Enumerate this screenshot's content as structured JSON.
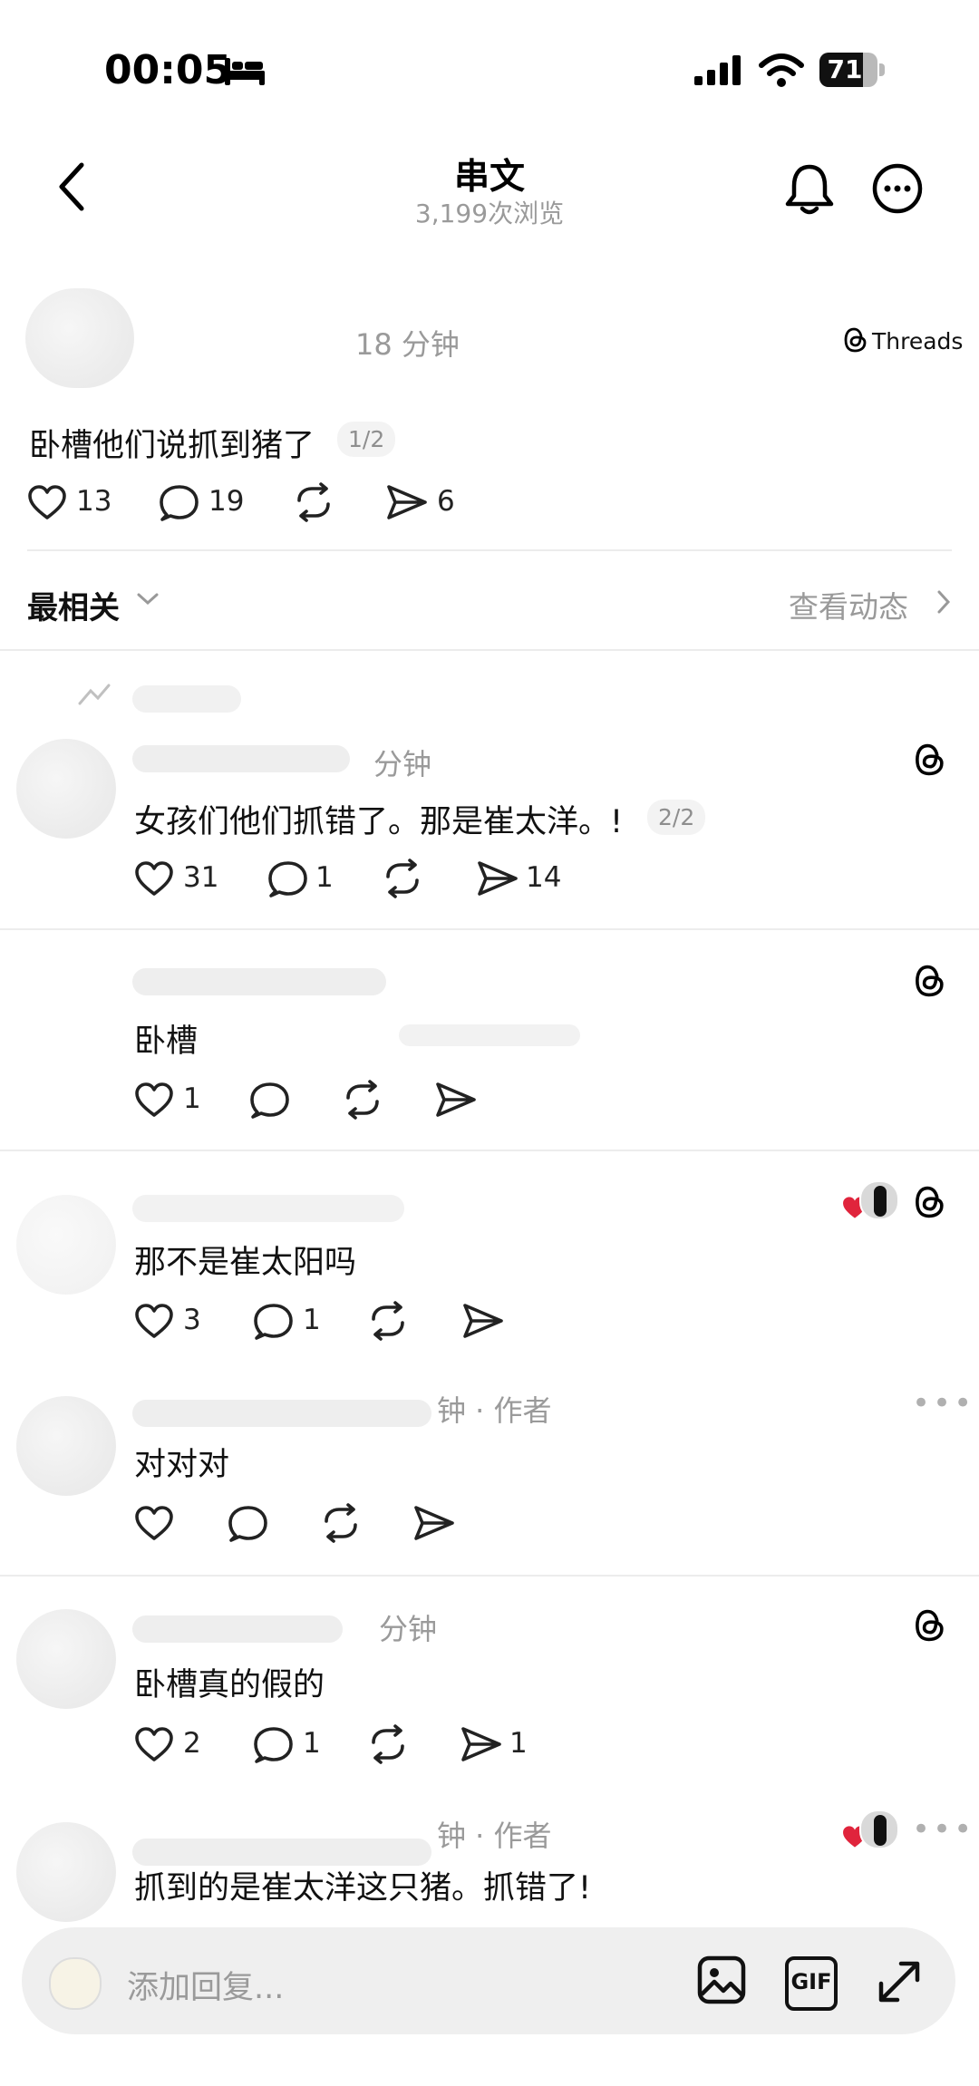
{
  "status_bar": {
    "time": "00:05",
    "battery": "71"
  },
  "header": {
    "title": "串文",
    "views": "3,199次浏览"
  },
  "post": {
    "time": "18 分钟",
    "brand": "Threads",
    "text": "卧槽他们说抓到猪了",
    "page": "1/2",
    "likes": "13",
    "replies": "19",
    "shares": "6"
  },
  "sort": {
    "label": "最相关",
    "activity_label": "查看动态"
  },
  "comments": [
    {
      "time": "分钟",
      "text": "女孩们他们抓错了。那是崔太洋。!",
      "page": "2/2",
      "likes": "31",
      "replies": "1",
      "shares": "14"
    },
    {
      "text": "卧槽",
      "likes": "1"
    },
    {
      "text": "那不是崔太阳吗",
      "likes": "3",
      "replies": "1"
    },
    {
      "meta": "钟 · 作者",
      "text": "对对对"
    },
    {
      "time": "分钟",
      "text": "卧槽真的假的",
      "likes": "2",
      "replies": "1",
      "shares": "1"
    },
    {
      "meta": "钟 · 作者",
      "text": "抓到的是崔太洋这只猪。抓错了!"
    }
  ],
  "reply_bar": {
    "placeholder": "添加回复...",
    "gif_label": "GIF"
  },
  "colors": {
    "heart_red": "#e0243c",
    "text": "#111111",
    "muted": "#9a9a9a"
  }
}
